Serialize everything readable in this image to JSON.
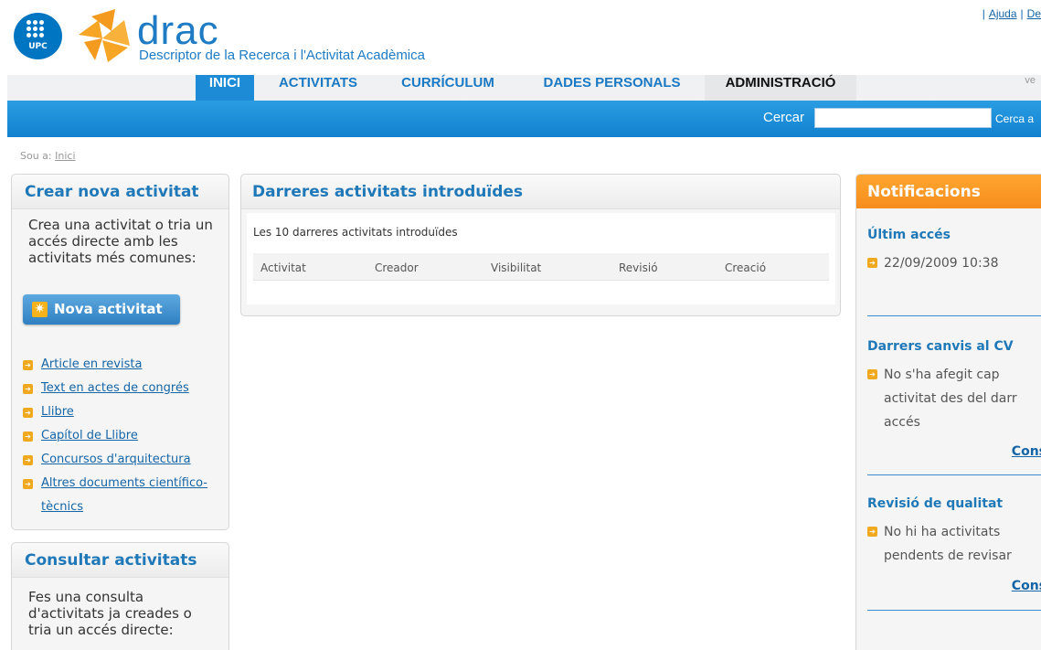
{
  "header": {
    "logo_upc": "UPC",
    "app_name": "drac",
    "tagline": "Descriptor de la Recerca i l'Activitat Acadèmica",
    "top_links": [
      "Ajuda",
      "De"
    ]
  },
  "nav": {
    "tabs": [
      {
        "label": "INICI",
        "active": true
      },
      {
        "label": "ACTIVITATS"
      },
      {
        "label": "CURRÍCULUM"
      },
      {
        "label": "DADES PERSONALS"
      },
      {
        "label": "ADMINISTRACIÓ"
      }
    ],
    "right_text": "ve"
  },
  "search": {
    "label": "Cercar",
    "value": "",
    "button": "Cerca a"
  },
  "breadcrumb": {
    "prefix": "Sou a:",
    "link": "Inici"
  },
  "create_panel": {
    "title": "Crear nova activitat",
    "description": "Crea una activitat o tria un accés directe amb les activitats més comunes:",
    "button": "Nova activitat",
    "links": [
      "Article en revista",
      "Text en actes de congrés",
      "Llibre",
      "Capítol de Llibre",
      "Concursos d'arquitectura",
      "Altres documents científico-tècnics"
    ]
  },
  "consult_panel": {
    "title": "Consultar activitats",
    "description": "Fes una consulta d'activitats ja creades o tria un accés directe:"
  },
  "recent_panel": {
    "title": "Darreres activitats introduïdes",
    "subtitle": "Les 10 darreres activitats introduïdes",
    "columns": [
      "Activitat",
      "Creador",
      "Visibilitat",
      "Revisió",
      "Creació"
    ],
    "rows": []
  },
  "notifications": {
    "title": "Notificacions",
    "last_access": {
      "heading": "Últim accés",
      "value": "22/09/2009 10:38"
    },
    "cv_changes": {
      "heading": "Darrers canvis al CV",
      "text": "No s'ha afegit cap activitat des del darr accés",
      "link": "Cons"
    },
    "quality": {
      "heading": "Revisió de qualitat",
      "text": "No hi ha activitats pendents de revisar",
      "link": "Cons"
    }
  },
  "colors": {
    "brand_blue": "#1e8bd6",
    "accent_orange": "#f68d1e",
    "link_blue": "#1565a6"
  }
}
